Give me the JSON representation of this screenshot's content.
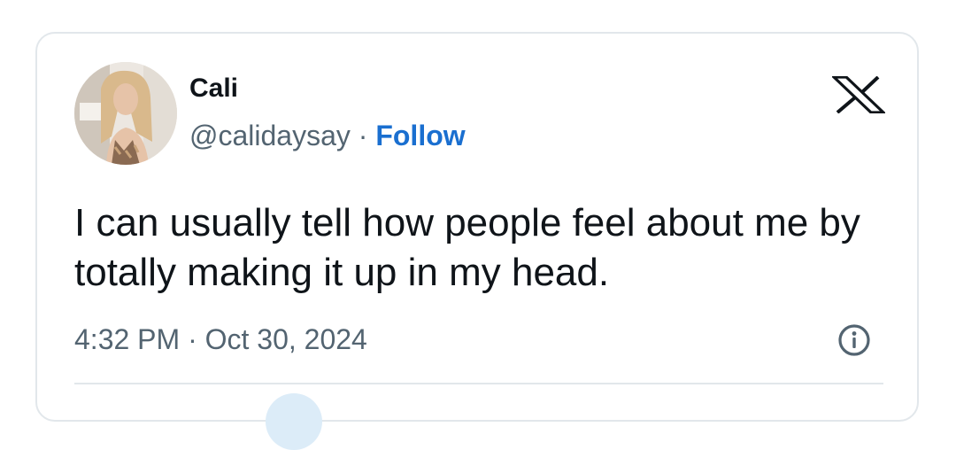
{
  "tweet": {
    "author": {
      "name": "Cali",
      "handle": "@calidaysay",
      "separator": " · ",
      "follow_label": "Follow"
    },
    "text": "I can usually tell how people feel about me by totally making it up in my head.",
    "time": "4:32 PM",
    "date_separator": " · ",
    "date": "Oct 30, 2024"
  },
  "icons": {
    "brand_logo": "x-logo-icon",
    "info": "info-icon"
  },
  "colors": {
    "text_primary": "#0f1419",
    "text_secondary": "#536471",
    "follow": "#1a6fd0",
    "border": "#e2e7eb"
  }
}
